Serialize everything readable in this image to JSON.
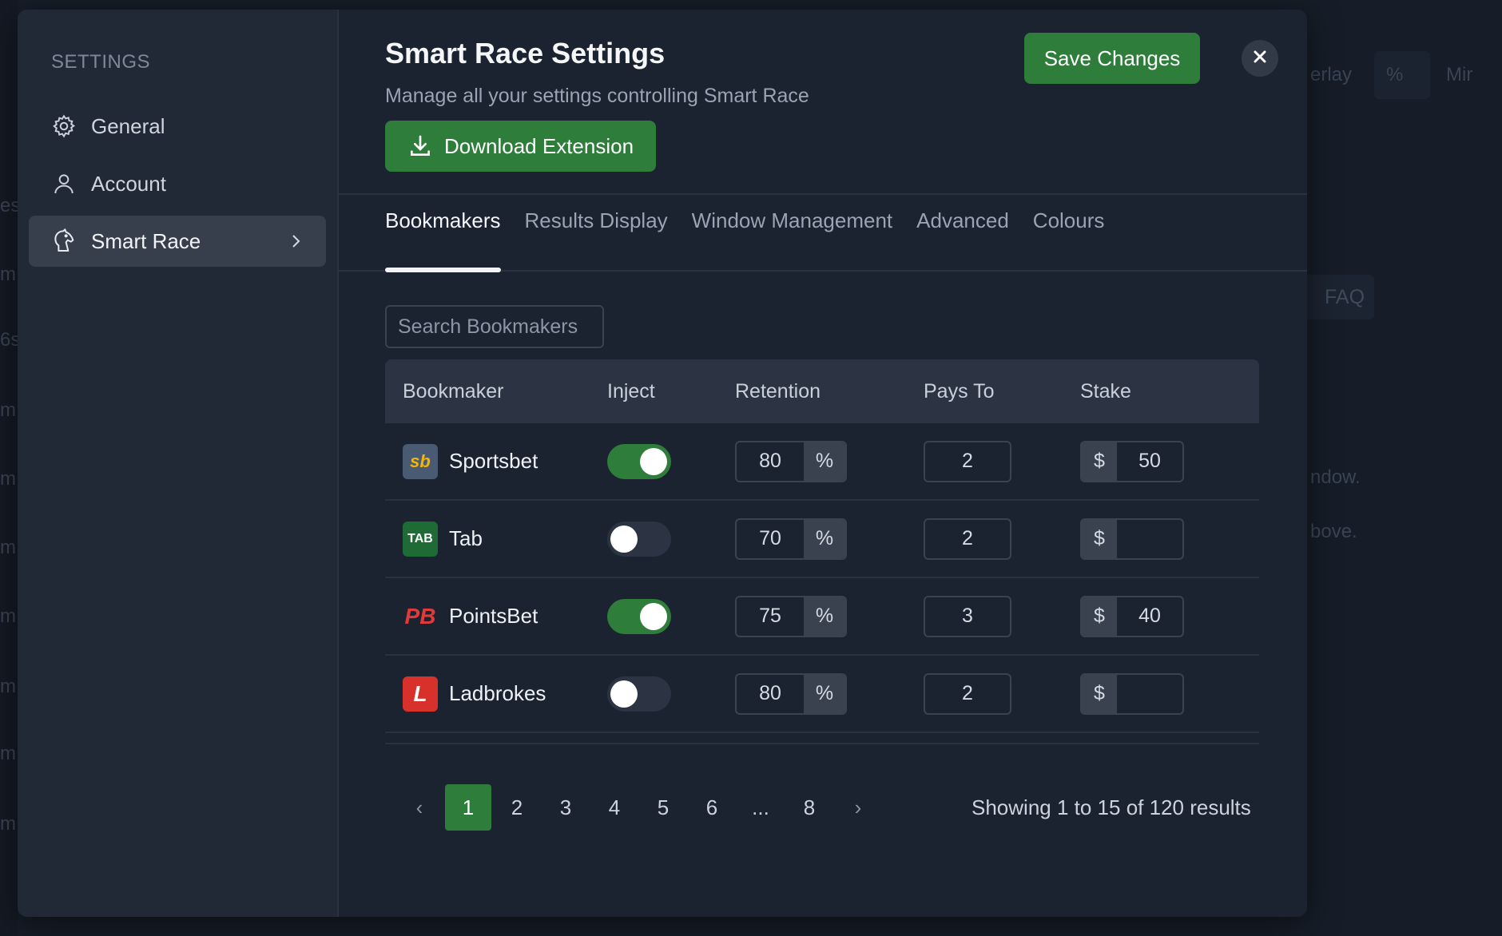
{
  "background": {
    "fragments": [
      "erlay",
      "%",
      "Mir",
      "ndow.",
      "bove.",
      "es",
      "m",
      "6s",
      "m",
      "m",
      "m",
      "m",
      "m",
      "m",
      "m"
    ],
    "faq_label": "FAQ"
  },
  "sidebar": {
    "title": "SETTINGS",
    "items": [
      {
        "label": "General",
        "icon": "gear-icon"
      },
      {
        "label": "Account",
        "icon": "user-icon"
      },
      {
        "label": "Smart Race",
        "icon": "horse-icon",
        "active": true
      }
    ]
  },
  "header": {
    "title": "Smart Race Settings",
    "subtitle": "Manage all your settings controlling Smart Race",
    "download_label": "Download Extension",
    "save_label": "Save Changes"
  },
  "tabs": [
    "Bookmakers",
    "Results Display",
    "Window Management",
    "Advanced",
    "Colours"
  ],
  "active_tab": "Bookmakers",
  "search": {
    "placeholder": "Search Bookmakers",
    "value": ""
  },
  "table": {
    "columns": [
      "Bookmaker",
      "Inject",
      "Retention",
      "Pays To",
      "Stake"
    ],
    "retention_unit": "%",
    "stake_unit": "$",
    "rows": [
      {
        "name": "Sportsbet",
        "logo_text": "sb",
        "logo_bg": "#4a5a73",
        "logo_fg": "#f2b705",
        "inject": true,
        "retention": "80",
        "pays_to": "2",
        "stake": "50"
      },
      {
        "name": "Tab",
        "logo_text": "TAB",
        "logo_bg": "#1f6b35",
        "logo_fg": "#ffffff",
        "inject": false,
        "retention": "70",
        "pays_to": "2",
        "stake": ""
      },
      {
        "name": "PointsBet",
        "logo_text": "PB",
        "logo_bg": "transparent",
        "logo_fg": "#e23a3a",
        "inject": true,
        "retention": "75",
        "pays_to": "3",
        "stake": "40"
      },
      {
        "name": "Ladbrokes",
        "logo_text": "L",
        "logo_bg": "#d8312c",
        "logo_fg": "#ffffff",
        "inject": false,
        "retention": "80",
        "pays_to": "2",
        "stake": ""
      }
    ]
  },
  "pagination": {
    "pages": [
      "1",
      "2",
      "3",
      "4",
      "5",
      "6",
      "...",
      "8"
    ],
    "current": "1",
    "prev": "‹",
    "next": "›",
    "summary": "Showing 1 to 15 of 120 results"
  },
  "colors": {
    "accent": "#2e7d3a",
    "modal_bg": "#1b2230",
    "sidebar_bg": "#222936"
  }
}
